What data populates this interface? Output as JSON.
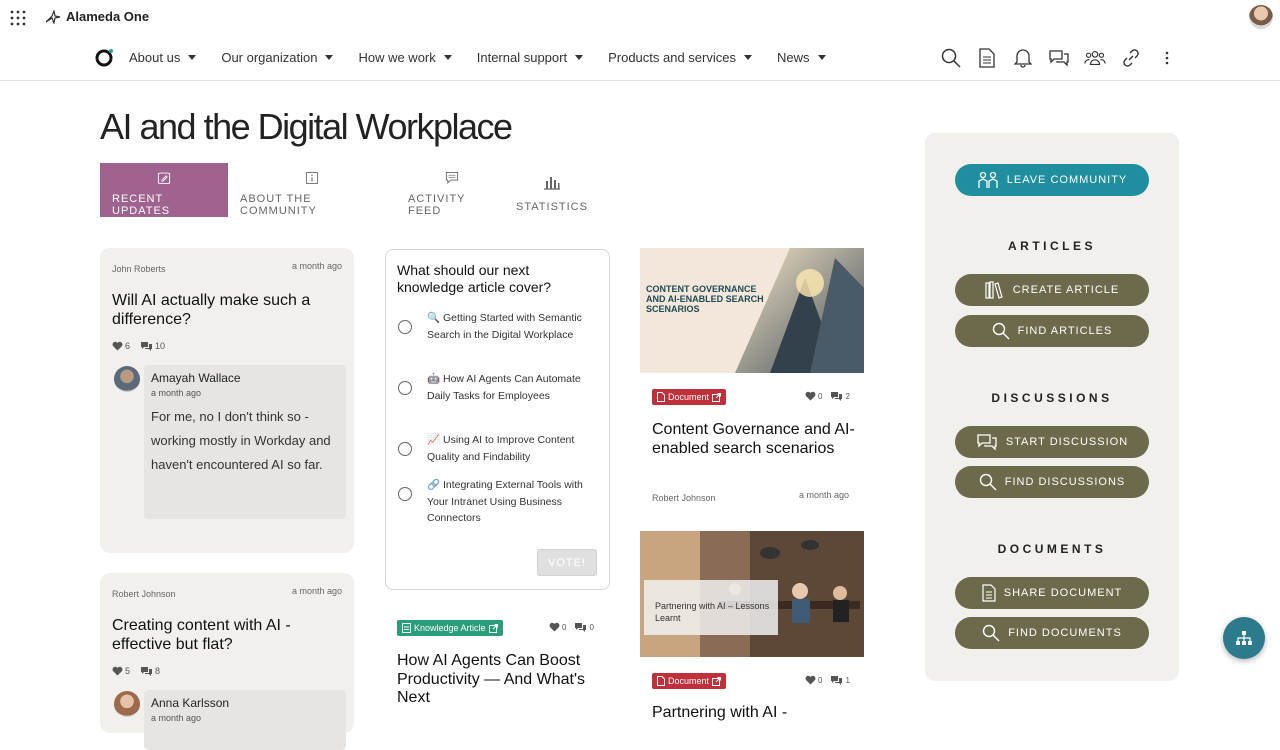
{
  "topbar": {
    "brand": "Alameda One"
  },
  "nav": {
    "items": [
      {
        "label": "About us"
      },
      {
        "label": "Our organization"
      },
      {
        "label": "How we work"
      },
      {
        "label": "Internal support"
      },
      {
        "label": "Products and services"
      },
      {
        "label": "News"
      }
    ],
    "tools": [
      "search-icon",
      "document-icon",
      "bell-icon",
      "chat-icon",
      "people-icon",
      "link-icon",
      "more-icon"
    ]
  },
  "page": {
    "title": "AI and the Digital Workplace"
  },
  "tabs": [
    {
      "label": "RECENT UPDATES",
      "active": true
    },
    {
      "label": "ABOUT THE COMMUNITY"
    },
    {
      "label": "ACTIVITY FEED"
    },
    {
      "label": "STATISTICS"
    }
  ],
  "posts": [
    {
      "author": "John Roberts",
      "ago": "a month ago",
      "title": "Will AI actually make such a difference?",
      "likes": "6",
      "comments": "10",
      "reply": {
        "name": "Amayah Wallace",
        "ago": "a month ago",
        "text": "For me, no I don't think so - working mostly in Workday and haven't encountered AI so far."
      }
    },
    {
      "author": "Robert Johnson",
      "ago": "a month ago",
      "title": "Creating content with AI - effective but flat?",
      "likes": "5",
      "comments": "8",
      "reply": {
        "name": "Anna Karlsson",
        "ago": "a month ago"
      }
    }
  ],
  "poll": {
    "title": "What should our next knowledge article cover?",
    "options": [
      {
        "icon": "🔍",
        "text": "Getting Started with Semantic Search in the Digital Workplace"
      },
      {
        "icon": "🤖",
        "text": "How AI Agents Can Automate Daily Tasks for Employees"
      },
      {
        "icon": "📈",
        "text": "Using AI to Improve Content Quality and Findability"
      },
      {
        "icon": "🔗",
        "text": "Integrating External Tools with Your Intranet Using Business Connectors"
      }
    ],
    "vote_label": "VOTE!"
  },
  "feed": [
    {
      "image_text": "CONTENT GOVERNANCE AND AI-ENABLED SEARCH SCENARIOS",
      "badge": "Document",
      "likes": "0",
      "comments": "2",
      "title": "Content Governance and AI-enabled search scenarios",
      "author": "Robert Johnson",
      "ago": "a month ago"
    },
    {
      "badge": "Knowledge Article",
      "likes": "0",
      "comments": "0",
      "title": "How AI Agents Can Boost Productivity — And What's Next"
    },
    {
      "image_text": "Partnering with AI – Lessons Learnt",
      "badge": "Document",
      "likes": "0",
      "comments": "1",
      "title": "Partnering with AI -"
    }
  ],
  "sidebar": {
    "leave": "LEAVE COMMUNITY",
    "articles": {
      "title": "ARTICLES",
      "create": "CREATE ARTICLE",
      "find": "FIND ARTICLES"
    },
    "discussions": {
      "title": "DISCUSSIONS",
      "start": "START DISCUSSION",
      "find": "FIND DISCUSSIONS"
    },
    "documents": {
      "title": "DOCUMENTS",
      "share": "SHARE DOCUMENT",
      "find": "FIND DOCUMENTS"
    }
  },
  "colors": {
    "accent_tab": "#a0628f",
    "teal": "#1f8fa0",
    "olive": "#6d6a4b",
    "doc_badge": "#c0303a",
    "ka_badge": "#2a9d7a"
  }
}
